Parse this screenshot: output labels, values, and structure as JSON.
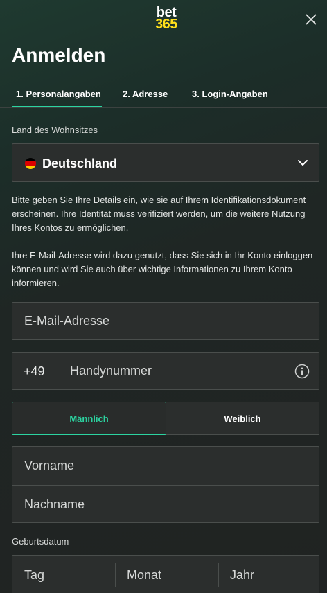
{
  "header": {
    "logo_line1": "bet",
    "logo_line2": "365",
    "title": "Anmelden"
  },
  "steps": [
    {
      "label": "1. Personalangaben",
      "active": true
    },
    {
      "label": "2. Adresse",
      "active": false
    },
    {
      "label": "3. Login-Angaben",
      "active": false
    }
  ],
  "residence": {
    "label": "Land des Wohnsitzes",
    "country": "Deutschland",
    "flag_colors": [
      "#000000",
      "#dd0000",
      "#ffce00"
    ]
  },
  "intro": {
    "paragraph1": "Bitte geben Sie Ihre Details ein, wie sie auf Ihrem Identifikationsdokument erscheinen. Ihre Identität muss verifiziert werden, um die weitere Nutzung Ihres Kontos zu ermöglichen.",
    "paragraph2": "Ihre E-Mail-Adresse wird dazu genutzt, dass Sie sich in Ihr Konto einloggen können und wird Sie auch über wichtige Informationen zu Ihrem Konto informieren."
  },
  "form": {
    "email_placeholder": "E-Mail-Adresse",
    "phone_prefix": "+49",
    "phone_placeholder": "Handynummer",
    "gender": {
      "male": "Männlich",
      "female": "Weiblich",
      "selected": "male"
    },
    "first_name_placeholder": "Vorname",
    "last_name_placeholder": "Nachname",
    "dob_label": "Geburtsdatum",
    "day_placeholder": "Tag",
    "month_placeholder": "Monat",
    "year_placeholder": "Jahr"
  },
  "colors": {
    "accent": "#2cd4a1",
    "brand_yellow": "#ffdf1b",
    "field_bg": "#2b2e2d"
  },
  "icons": {
    "close": "close-icon",
    "chevron": "chevron-down-icon",
    "info": "info-icon"
  }
}
